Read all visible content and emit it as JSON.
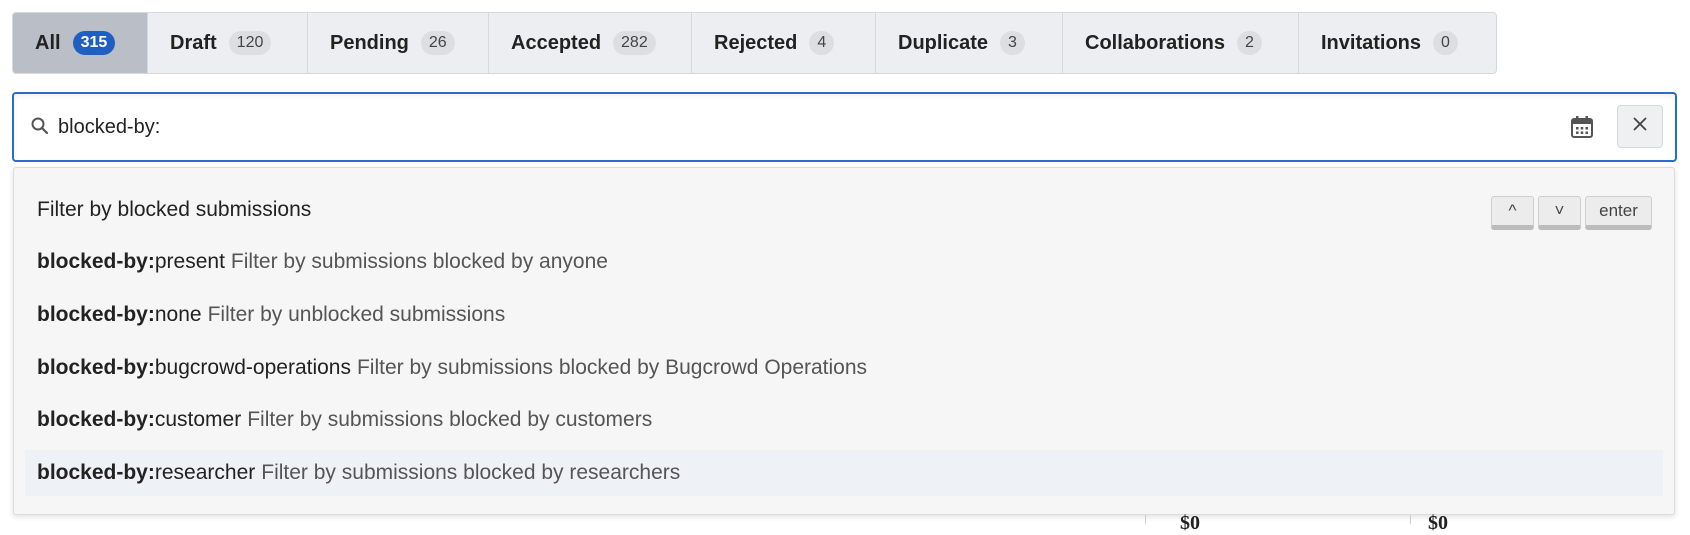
{
  "tabs": [
    {
      "label": "All",
      "count": "315",
      "active": true
    },
    {
      "label": "Draft",
      "count": "120"
    },
    {
      "label": "Pending",
      "count": "26"
    },
    {
      "label": "Accepted",
      "count": "282"
    },
    {
      "label": "Rejected",
      "count": "4"
    },
    {
      "label": "Duplicate",
      "count": "3"
    },
    {
      "label": "Collaborations",
      "count": "2"
    },
    {
      "label": "Invitations",
      "count": "0"
    }
  ],
  "search": {
    "value": "blocked-by:",
    "icons": [
      "search-icon",
      "calendar-icon",
      "close-icon"
    ]
  },
  "dropdown": {
    "heading": "Filter by blocked submissions",
    "keys": {
      "up": "^",
      "down": "˅",
      "enter": "enter"
    },
    "items": [
      {
        "prefix": "blocked-by:",
        "value": "present",
        "desc": "Filter by submissions blocked by anyone"
      },
      {
        "prefix": "blocked-by:",
        "value": "none",
        "desc": "Filter by unblocked submissions"
      },
      {
        "prefix": "blocked-by:",
        "value": "bugcrowd-operations",
        "desc": "Filter by submissions blocked by Bugcrowd Operations"
      },
      {
        "prefix": "blocked-by:",
        "value": "customer",
        "desc": "Filter by submissions blocked by customers"
      },
      {
        "prefix": "blocked-by:",
        "value": "researcher",
        "desc": "Filter by submissions blocked by researchers"
      }
    ]
  },
  "background": {
    "amounts": [
      "$0",
      "$0"
    ]
  },
  "colors": {
    "accent": "#2d6bc9",
    "active_badge": "#1f5fc2",
    "active_tab": "#b9bec7"
  }
}
